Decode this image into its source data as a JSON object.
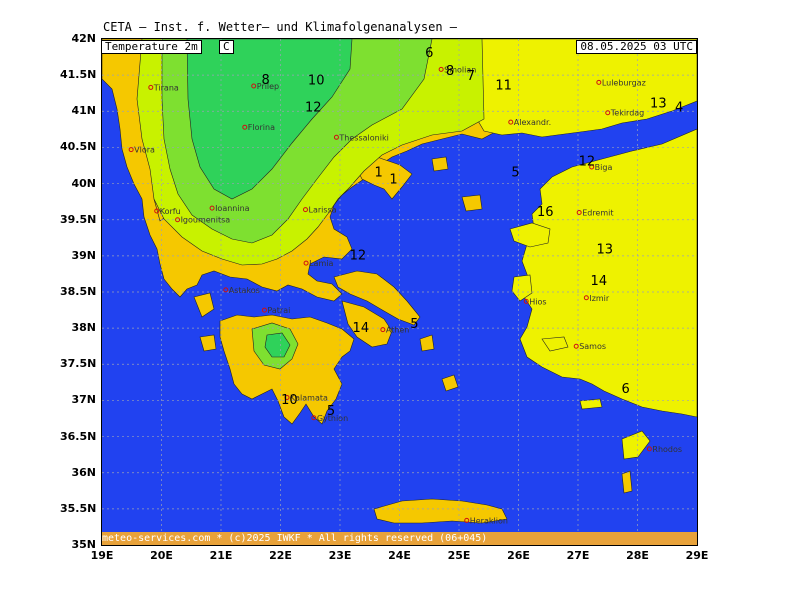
{
  "header": {
    "title": "CETA — Inst. f. Wetter— und Klimafolgenanalysen —"
  },
  "map": {
    "variable_label": "Temperature 2m",
    "unit_label": "C",
    "datetime_label": "08.05.2025 03 UTC",
    "footer": "meteo-services.com * (c)2025 IWKF * All rights reserved (06+045)",
    "lat_labels": [
      "42N",
      "41.5N",
      "41N",
      "40.5N",
      "40N",
      "39.5N",
      "39N",
      "38.5N",
      "38N",
      "37.5N",
      "37N",
      "36.5N",
      "36N",
      "35.5N",
      "35N"
    ],
    "lon_labels": [
      "19E",
      "20E",
      "21E",
      "22E",
      "23E",
      "24E",
      "25E",
      "26E",
      "27E",
      "28E",
      "29E"
    ],
    "extent": {
      "lon_min": 19,
      "lon_max": 29,
      "lat_min": 35,
      "lat_max": 42
    },
    "colors": {
      "sea": "#2142f0",
      "warm": "#f5c800",
      "yellow": "#eef200",
      "lime": "#c8f200",
      "green": "#7ee030",
      "deepgreen": "#2fd25a",
      "grid": "#9aa0b8",
      "footer_bg": "#e8a23a"
    },
    "cities": [
      {
        "name": "Tirana",
        "lon": 19.82,
        "lat": 41.33
      },
      {
        "name": "Vlora",
        "lon": 19.49,
        "lat": 40.47
      },
      {
        "name": "Prilep",
        "lon": 21.55,
        "lat": 41.35
      },
      {
        "name": "Florina",
        "lon": 21.4,
        "lat": 40.78
      },
      {
        "name": "Smolian",
        "lon": 24.7,
        "lat": 41.58
      },
      {
        "name": "Thessaloniki",
        "lon": 22.94,
        "lat": 40.64
      },
      {
        "name": "Alexandr.",
        "lon": 25.87,
        "lat": 40.85
      },
      {
        "name": "Luleburgaz",
        "lon": 27.35,
        "lat": 41.4
      },
      {
        "name": "Tekirdag",
        "lon": 27.5,
        "lat": 40.98
      },
      {
        "name": "Biga",
        "lon": 27.23,
        "lat": 40.23
      },
      {
        "name": "Korfu",
        "lon": 19.92,
        "lat": 39.62
      },
      {
        "name": "Ioannina",
        "lon": 20.85,
        "lat": 39.66
      },
      {
        "name": "Igoumenitsa",
        "lon": 20.27,
        "lat": 39.5
      },
      {
        "name": "Larissa",
        "lon": 22.42,
        "lat": 39.64
      },
      {
        "name": "Lamia",
        "lon": 22.43,
        "lat": 38.9
      },
      {
        "name": "Edremit",
        "lon": 27.02,
        "lat": 39.6
      },
      {
        "name": "Astakos",
        "lon": 21.08,
        "lat": 38.53
      },
      {
        "name": "Patrai",
        "lon": 21.73,
        "lat": 38.25
      },
      {
        "name": "Athen",
        "lon": 23.72,
        "lat": 37.98
      },
      {
        "name": "Izmir",
        "lon": 27.14,
        "lat": 38.42
      },
      {
        "name": "Hios",
        "lon": 26.13,
        "lat": 38.37
      },
      {
        "name": "Samos",
        "lon": 26.97,
        "lat": 37.75
      },
      {
        "name": "Kalamata",
        "lon": 22.11,
        "lat": 37.04
      },
      {
        "name": "Gythion",
        "lon": 22.56,
        "lat": 36.76
      },
      {
        "name": "Rhodos",
        "lon": 28.2,
        "lat": 36.33
      },
      {
        "name": "Heraklion",
        "lon": 25.13,
        "lat": 35.34
      }
    ],
    "contour_labels": [
      {
        "text": "6",
        "lon": 24.5,
        "lat": 41.75
      },
      {
        "text": "8",
        "lon": 21.75,
        "lat": 41.38
      },
      {
        "text": "10",
        "lon": 22.6,
        "lat": 41.37
      },
      {
        "text": "8",
        "lon": 24.85,
        "lat": 41.5
      },
      {
        "text": "7",
        "lon": 25.2,
        "lat": 41.43
      },
      {
        "text": "11",
        "lon": 25.75,
        "lat": 41.3
      },
      {
        "text": "12",
        "lon": 22.55,
        "lat": 41.0
      },
      {
        "text": "1",
        "lon": 23.65,
        "lat": 40.1
      },
      {
        "text": "1",
        "lon": 23.9,
        "lat": 40.0
      },
      {
        "text": "5",
        "lon": 25.95,
        "lat": 40.1
      },
      {
        "text": "12",
        "lon": 27.15,
        "lat": 40.25
      },
      {
        "text": "13",
        "lon": 28.35,
        "lat": 41.05
      },
      {
        "text": "4",
        "lon": 28.7,
        "lat": 41.0
      },
      {
        "text": "16",
        "lon": 26.45,
        "lat": 39.55
      },
      {
        "text": "12",
        "lon": 23.3,
        "lat": 38.95
      },
      {
        "text": "13",
        "lon": 27.45,
        "lat": 39.03
      },
      {
        "text": "14",
        "lon": 27.35,
        "lat": 38.6
      },
      {
        "text": "5",
        "lon": 24.25,
        "lat": 38.0
      },
      {
        "text": "14",
        "lon": 23.35,
        "lat": 37.95
      },
      {
        "text": "10",
        "lon": 22.15,
        "lat": 36.95
      },
      {
        "text": "5",
        "lon": 22.85,
        "lat": 36.8
      },
      {
        "text": "6",
        "lon": 27.8,
        "lat": 37.1
      }
    ]
  }
}
